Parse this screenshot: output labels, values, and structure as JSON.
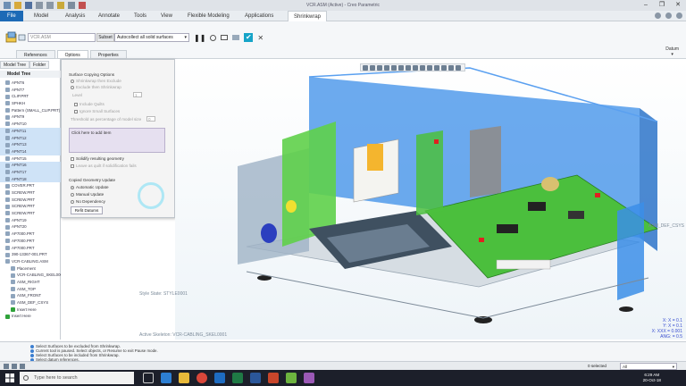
{
  "window": {
    "title": "VCR.ASM (Active) - Creo Parametric",
    "controls": [
      "–",
      "❐",
      "✕"
    ]
  },
  "ribbon": {
    "tabs": [
      "File",
      "Model",
      "Analysis",
      "Annotate",
      "Tools",
      "View",
      "Flexible Modeling",
      "Applications",
      "Shrinkwrap"
    ]
  },
  "dashboard": {
    "reference_value": "VCR.ASM",
    "subset_label": "Subset",
    "subset_selected": "Autocollect all solid surfaces",
    "datum_label": "Datum",
    "tabs": [
      "References",
      "Options",
      "Properties"
    ],
    "active_tab": "Options",
    "apply_glyph": "✔",
    "cancel_glyph": "✕"
  },
  "model_tree": {
    "tabs": [
      "Model Tree",
      "Folder"
    ],
    "header": "Model Tree",
    "items": [
      {
        "label": "APNT6",
        "highlight": false
      },
      {
        "label": "APNT7",
        "highlight": false
      },
      {
        "label": "CLIP.PRT",
        "highlight": false
      },
      {
        "label": "SPHKH",
        "highlight": false
      },
      {
        "label": "Pattern (SMALL_CLIP.PRT)",
        "highlight": false
      },
      {
        "label": "APNT9",
        "highlight": false
      },
      {
        "label": "APNT10",
        "highlight": false
      },
      {
        "label": "APNT11",
        "highlight": true
      },
      {
        "label": "APNT12",
        "highlight": true
      },
      {
        "label": "APNT13",
        "highlight": true
      },
      {
        "label": "APNT14",
        "highlight": true
      },
      {
        "label": "APNT15",
        "highlight": false
      },
      {
        "label": "APNT16",
        "highlight": true
      },
      {
        "label": "APNT17",
        "highlight": true
      },
      {
        "label": "APNT18",
        "highlight": true
      },
      {
        "label": "COVER.PRT",
        "highlight": false
      },
      {
        "label": "SCREW.PRT",
        "highlight": false
      },
      {
        "label": "SCREW.PRT",
        "highlight": false
      },
      {
        "label": "SCREW.PRT",
        "highlight": false
      },
      {
        "label": "SCREW.PRT",
        "highlight": false
      },
      {
        "label": "APNT19",
        "highlight": false
      },
      {
        "label": "APNT20",
        "highlight": false
      },
      {
        "label": "AP7000.PRT",
        "highlight": false
      },
      {
        "label": "AP7000.PRT",
        "highlight": false
      },
      {
        "label": "AP7000.PRT",
        "highlight": false
      },
      {
        "label": "390-13367-001.PRT",
        "highlight": false
      },
      {
        "label": "VCR-CABLING.ASM",
        "highlight": false
      },
      {
        "label": "Placement",
        "highlight": false
      },
      {
        "label": "VCR-CABLING_SKEL0001.PRT",
        "highlight": false
      },
      {
        "label": "ASM_RIGHT",
        "highlight": false
      },
      {
        "label": "ASM_TOP",
        "highlight": false
      },
      {
        "label": "ASM_FRONT",
        "highlight": false
      },
      {
        "label": "ASM_DEF_CSYS",
        "highlight": false
      },
      {
        "label": "Insert Here",
        "highlight": false
      },
      {
        "label": "Insert Here",
        "highlight": false
      }
    ]
  },
  "options_panel": {
    "surface_copying_title": "Surface Copying Options",
    "radio_exclude": "Shrinkwrap then Exclude",
    "radio_exclude_from": "Exclude then Shrinkwrap",
    "level_label": "Level",
    "level_value": "1",
    "include_quilts": "Include Quilts",
    "ignore_small": "Ignore Small Surfaces",
    "threshold_label": "Threshold as percentage of model size",
    "threshold_value": "0",
    "collector_text": "Click here to add item",
    "solidify": "Solidify resulting geometry",
    "leave_quilt": "Leave as quilt if solidification fails",
    "copied_update_title": "Copied Geometry Update",
    "auto_update": "Automatic Update",
    "manual_update": "Manual Update",
    "no_dependency": "No Dependency",
    "refit_button": "Refit Datums"
  },
  "viewport": {
    "style_state": "Style State: STYLE0001",
    "active_skeleton": "Active Skeleton: VCR-CABLING_SKEL0001",
    "csys_label": "ASM_DEF_CSYS",
    "readout": [
      "X: X = 0.1",
      "Y: X = 0.1",
      "X: XXX = 0.001",
      "ANG: = 0.5"
    ]
  },
  "messages": [
    "Select Surfaces to be excluded from Shrinkwrap.",
    "Current tool is paused. Select objects, or Resume to exit Pause mode.",
    "Select Surfaces to be included from Shrinkwrap.",
    "Select datum references."
  ],
  "statusbar": {
    "selected": "0 selected",
    "filter": "All"
  },
  "taskbar": {
    "search_placeholder": "Type here to search",
    "time": "6:29 AM",
    "date": "20-Oct-18"
  },
  "colors": {
    "file_tab": "#1d6ab6",
    "apply": "#16a4c8",
    "tree_highlight": "#cfe3f7",
    "cursor_ring": "#aee7f5",
    "model_blue": "#3b8ee8",
    "pcb_green": "#4bbf3d",
    "chassis": "#aab6c4"
  },
  "icons": {
    "search": "search-icon",
    "windows": "windows-logo-icon",
    "apply": "checkmark-icon",
    "close": "close-icon"
  }
}
